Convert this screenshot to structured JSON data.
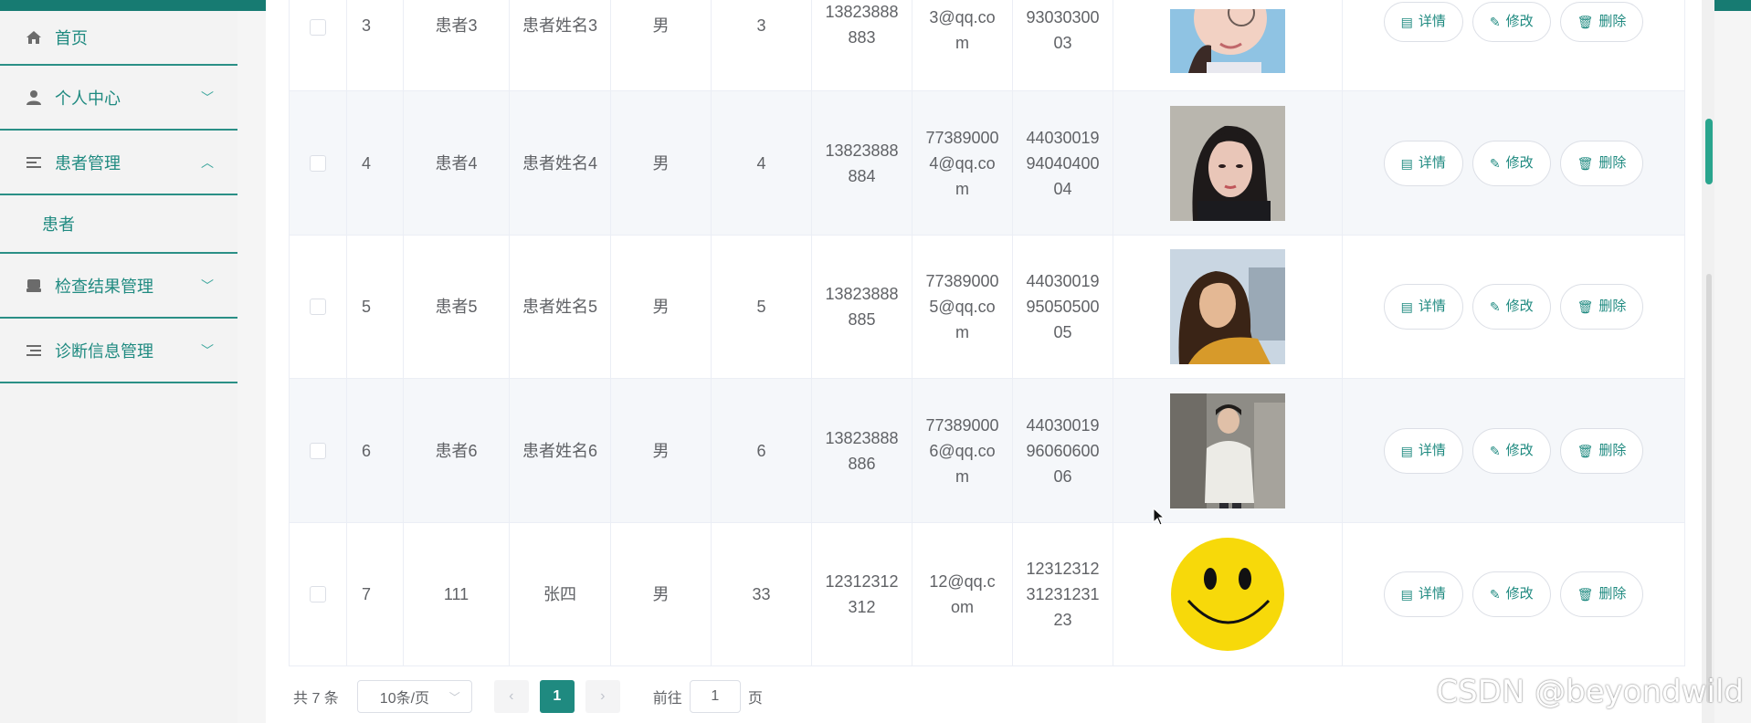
{
  "sidebar": {
    "items": [
      {
        "label": "首页",
        "icon": "home-icon"
      },
      {
        "label": "个人中心",
        "icon": "user-icon"
      },
      {
        "label": "患者管理",
        "icon": "list-icon",
        "submenu": [
          "患者"
        ]
      },
      {
        "label": "检查结果管理",
        "icon": "inbox-icon"
      },
      {
        "label": "诊断信息管理",
        "icon": "menu-lines-icon"
      }
    ]
  },
  "table": {
    "rows": [
      {
        "index": "3",
        "account": "患者3",
        "name": "患者姓名3",
        "gender": "男",
        "age": "3",
        "phone": "13823888\n883",
        "email": "3@qq.co\nm",
        "idcard": "93030300\n03",
        "photo": "girl-glasses-photo"
      },
      {
        "index": "4",
        "account": "患者4",
        "name": "患者姓名4",
        "gender": "男",
        "age": "4",
        "phone": "13823888\n884",
        "email": "77389000\n4@qq.co\nm",
        "idcard": "44030019\n94040400\n04",
        "photo": "girl-portrait-photo"
      },
      {
        "index": "5",
        "account": "患者5",
        "name": "患者姓名5",
        "gender": "男",
        "age": "5",
        "phone": "13823888\n885",
        "email": "77389000\n5@qq.co\nm",
        "idcard": "44030019\n95050500\n05",
        "photo": "girl-outdoor-photo"
      },
      {
        "index": "6",
        "account": "患者6",
        "name": "患者姓名6",
        "gender": "男",
        "age": "6",
        "phone": "13823888\n886",
        "email": "77389000\n6@qq.co\nm",
        "idcard": "44030019\n96060600\n06",
        "photo": "boy-street-photo"
      },
      {
        "index": "7",
        "account": "111",
        "name": "张四",
        "gender": "男",
        "age": "33",
        "phone": "12312312\n312",
        "email": "12@qq.c\nom",
        "idcard": "12312312\n31231231\n23",
        "photo": "smiley-face-photo"
      }
    ],
    "actions": {
      "detail": "详情",
      "edit": "修改",
      "delete": "删除"
    }
  },
  "pager": {
    "total": "共 7 条",
    "page_size": "10条/页",
    "current_page": "1",
    "goto_prefix": "前往",
    "goto_value": "1",
    "goto_suffix": "页"
  },
  "watermark": "CSDN @beyondwild",
  "colors": {
    "accent": "#1f8a80",
    "topbar": "#177b72",
    "border": "#ebeef5"
  }
}
